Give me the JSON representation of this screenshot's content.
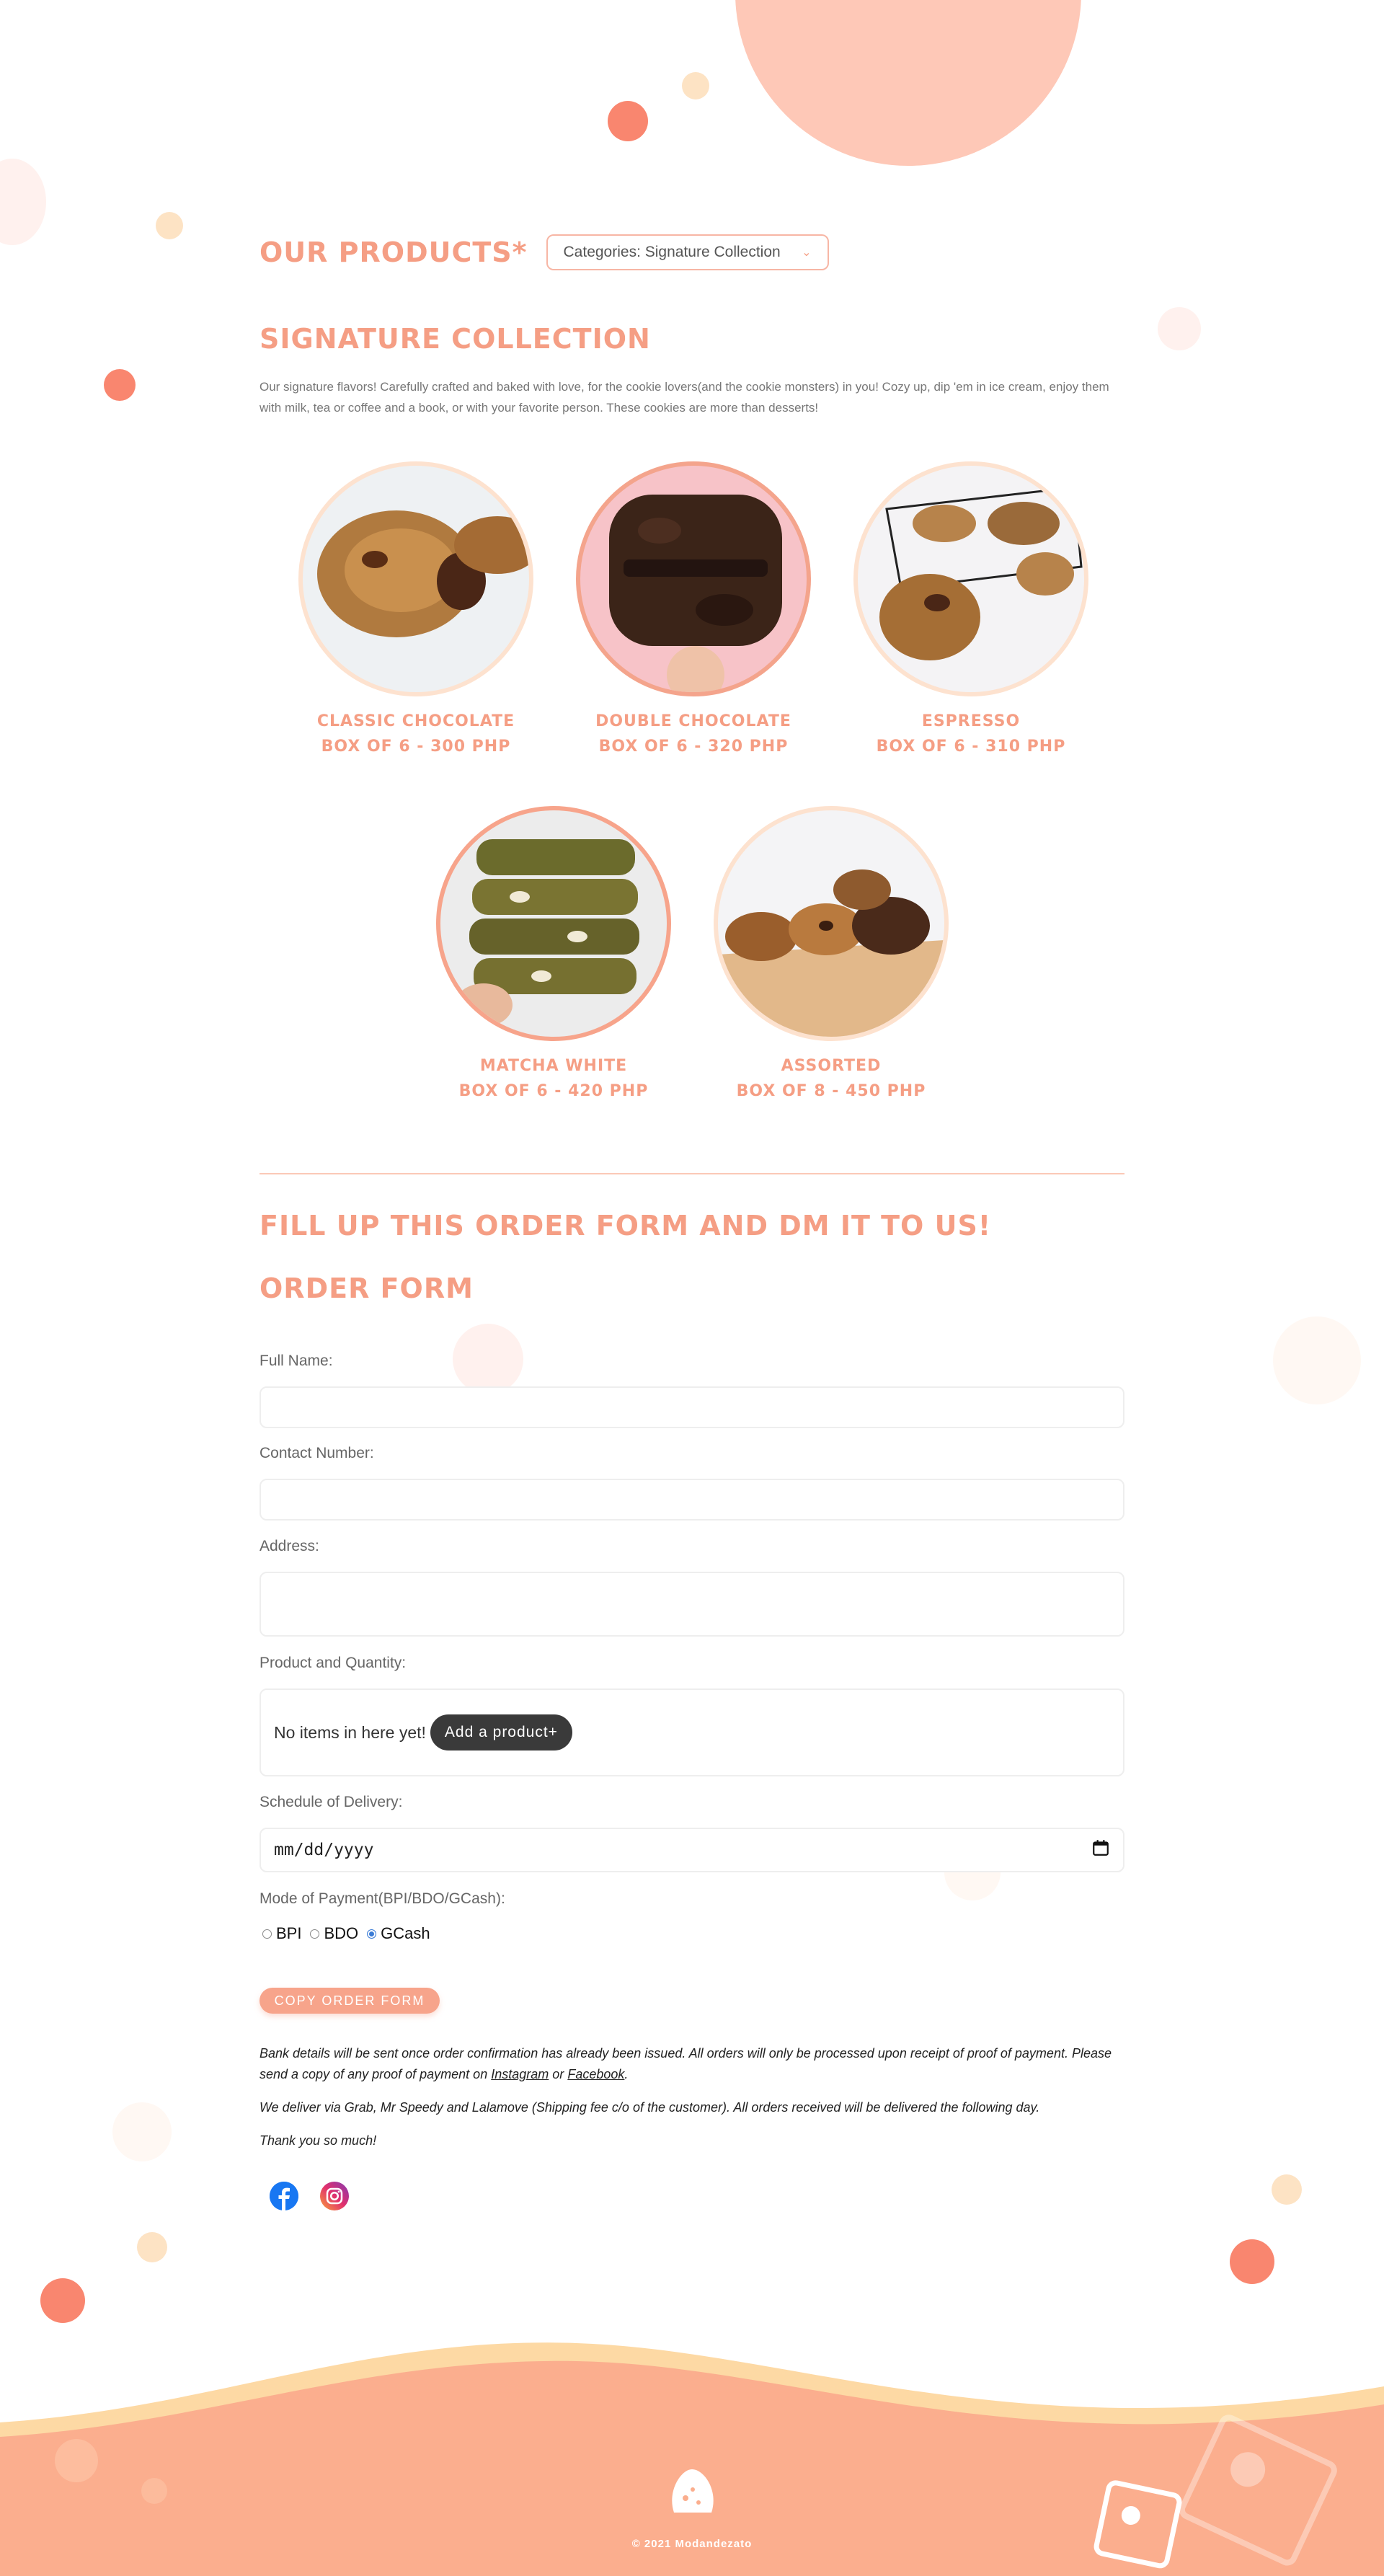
{
  "products_header": {
    "title": "OUR PRODUCTS*",
    "category_label": "Categories: Signature Collection"
  },
  "collection": {
    "title": "SIGNATURE COLLECTION",
    "description": "Our signature flavors! Carefully crafted and baked with love, for the cookie lovers(and the cookie monsters) in you! Cozy up, dip 'em in ice cream, enjoy them with milk, tea or coffee and a book, or with your favorite person. These cookies are more than desserts!"
  },
  "products": [
    {
      "name": "CLASSIC CHOCOLATE",
      "price": "BOX OF 6 - 300 PHP"
    },
    {
      "name": "DOUBLE CHOCOLATE",
      "price": "BOX OF 6 - 320 PHP"
    },
    {
      "name": "ESPRESSO",
      "price": "BOX OF 6 - 310 PHP"
    },
    {
      "name": "MATCHA WHITE",
      "price": "BOX OF 6 - 420 PHP"
    },
    {
      "name": "ASSORTED",
      "price": "BOX OF 8 - 450 PHP"
    }
  ],
  "order": {
    "dm_title": "FILL UP THIS ORDER FORM AND DM IT TO US!",
    "form_title": "ORDER FORM",
    "full_name_label": "Full Name:",
    "contact_label": "Contact Number:",
    "address_label": "Address:",
    "product_label": "Product and Quantity:",
    "empty_text": "No items in here yet!",
    "add_product_label": "Add a product+",
    "schedule_label": "Schedule of Delivery:",
    "date_placeholder": "mm/dd/yyyy",
    "payment_label": "Mode of Payment(BPI/BDO/GCash):",
    "payment_options": [
      "BPI",
      "BDO",
      "GCash"
    ],
    "payment_selected": "GCash",
    "copy_button": "COPY ORDER FORM"
  },
  "notes": {
    "bank_text": "Bank details will be sent once order confirmation has already been issued. All orders will only be processed upon receipt of proof of payment. Please send a copy of any proof of payment on",
    "instagram_link": "Instagram",
    "or_text": "or",
    "facebook_link": "Facebook",
    "period": ".",
    "delivery_text": "We deliver via Grab, Mr Speedy and Lalamove (Shipping fee c/o of the customer). All orders received will be delivered the following day.",
    "thanks_text": "Thank you so much!"
  },
  "socials": {
    "facebook_icon": "facebook-icon",
    "instagram_icon": "instagram-icon"
  },
  "footer": {
    "copyright": "© 2021 Modandezato"
  },
  "colors": {
    "accent": "#f59e84",
    "peach": "#fec8b7",
    "footer": "#fbae8e",
    "footer_wave": "#fdd9a4"
  }
}
